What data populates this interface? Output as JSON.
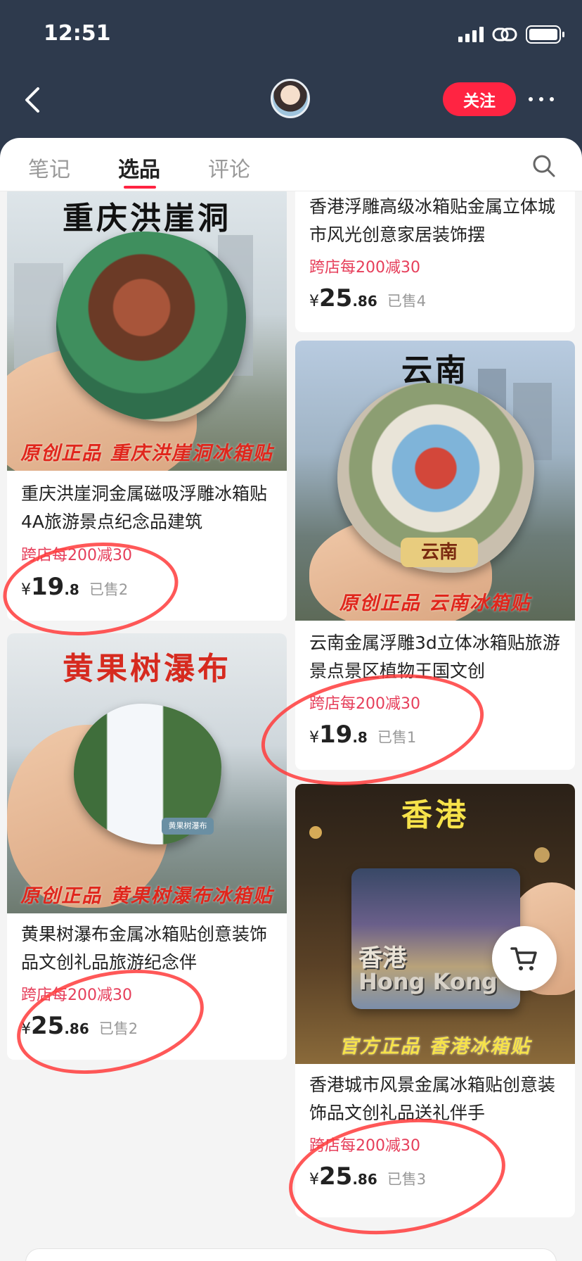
{
  "status_bar": {
    "time": "12:51"
  },
  "header": {
    "follow_label": "关注"
  },
  "tabs": [
    {
      "label": "笔记",
      "active": false
    },
    {
      "label": "选品",
      "active": true
    },
    {
      "label": "评论",
      "active": false
    }
  ],
  "colors": {
    "accent": "#ff2442",
    "promo": "#e63e5a",
    "header_bg": "#2e3a4d"
  },
  "products": [
    {
      "image_title": "重庆洪崖洞",
      "image_footer": "原创正品 重庆洪崖洞冰箱贴",
      "title": "重庆洪崖洞金属磁吸浮雕冰箱贴4A旅游景点纪念品建筑",
      "promo": "跨店每200减30",
      "price_symbol": "¥",
      "price_int": "19",
      "price_dec": ".8",
      "sold": "已售2"
    },
    {
      "image_title": "",
      "image_footer": "",
      "title": "香港浮雕高级冰箱贴金属立体城市风光创意家居装饰摆",
      "promo": "跨店每200减30",
      "price_symbol": "¥",
      "price_int": "25",
      "price_dec": ".86",
      "sold": "已售4"
    },
    {
      "image_title": "云南",
      "image_footer": "原创正品 云南冰箱贴",
      "magnet_label": "云南",
      "title": "云南金属浮雕3d立体冰箱贴旅游景点景区植物王国文创",
      "promo": "跨店每200减30",
      "price_symbol": "¥",
      "price_int": "19",
      "price_dec": ".8",
      "sold": "已售1"
    },
    {
      "image_title": "黄果树瀑布",
      "image_footer": "原创正品 黄果树瀑布冰箱贴",
      "magnet_label": "黄果树瀑布",
      "title": "黄果树瀑布金属冰箱贴创意装饰品文创礼品旅游纪念伴",
      "promo": "跨店每200减30",
      "price_symbol": "¥",
      "price_int": "25",
      "price_dec": ".86",
      "sold": "已售2"
    },
    {
      "image_title": "香港",
      "image_footer": "官方正品 香港冰箱贴",
      "magnet_label_cn": "香港",
      "magnet_label_en": "Hong Kong",
      "title": "香港城市风景金属冰箱贴创意装饰品文创礼品送礼伴手",
      "promo": "跨店每200减30",
      "price_symbol": "¥",
      "price_int": "25",
      "price_dec": ".86",
      "sold": "已售3"
    }
  ]
}
